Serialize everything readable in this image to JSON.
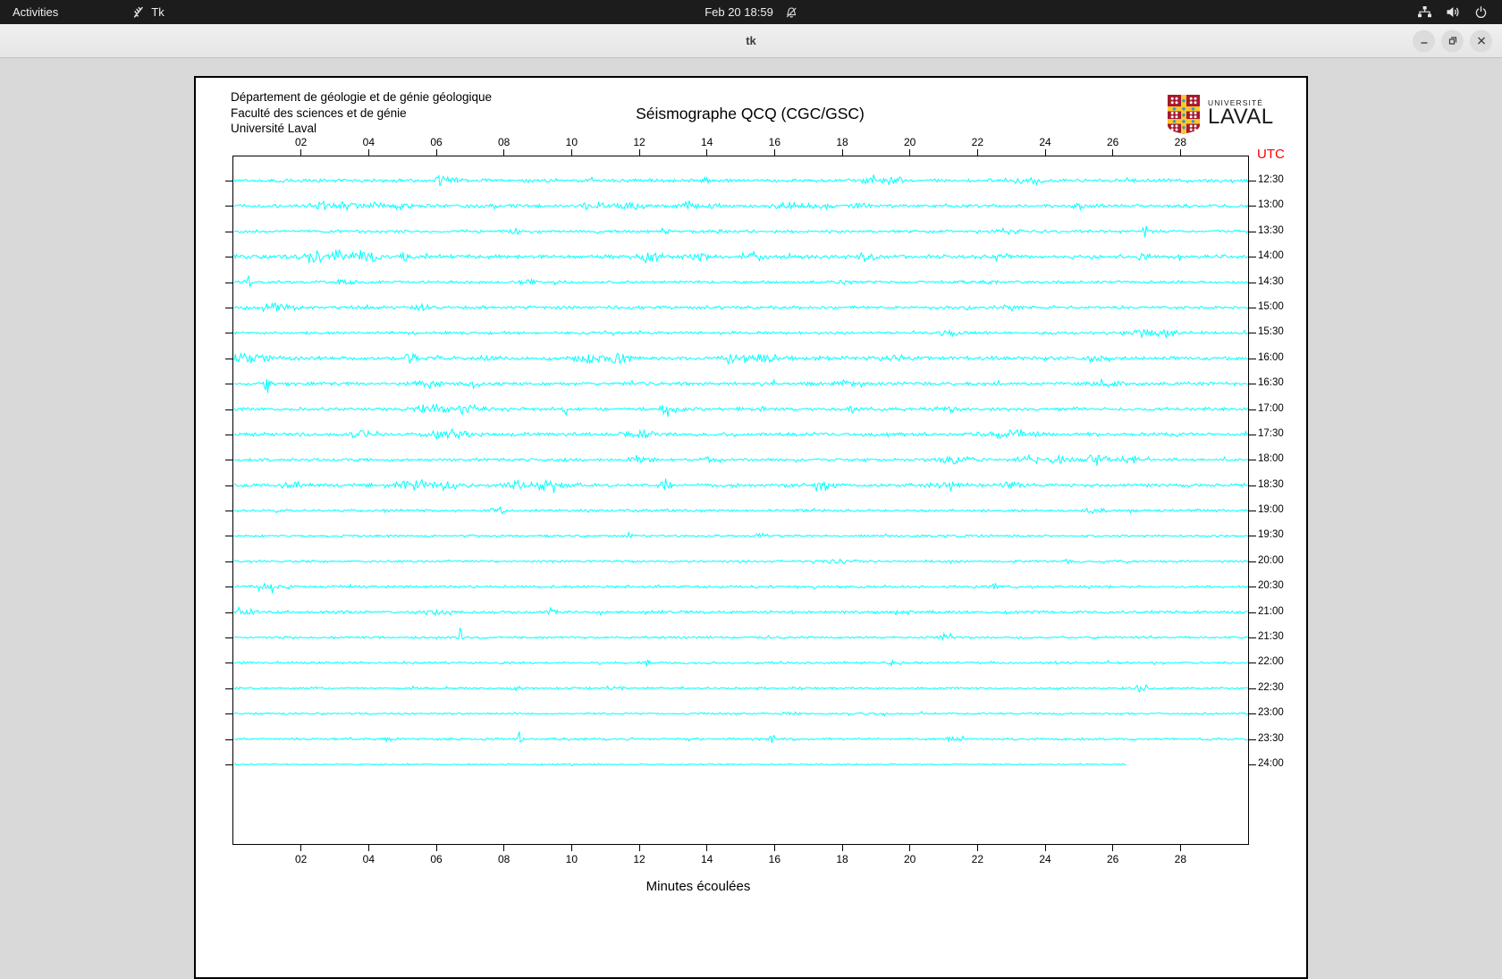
{
  "top_bar": {
    "activities_label": "Activities",
    "app_name": "Tk",
    "clock": "Feb 20 18:59",
    "status_icons": [
      "network-icon",
      "volume-icon",
      "power-icon"
    ],
    "notifications": "disabled"
  },
  "window": {
    "title": "tk",
    "controls": [
      "minimize",
      "maximize",
      "close"
    ]
  },
  "document": {
    "header_lines": [
      "Département de géologie et de génie géologique",
      "Faculté des sciences et de génie",
      "Université Laval"
    ],
    "title": "Séismographe QCQ (CGC/GSC)",
    "logo": {
      "line1": "UNIVERSITÉ",
      "line2": "LAVAL"
    },
    "utc_label": "UTC",
    "xlabel": "Minutes écoulées"
  },
  "colors": {
    "trace": "#00ffff",
    "utc_label": "#ff0000",
    "axis": "#000000",
    "logo_red": "#a6192e",
    "logo_yellow": "#ffc72c",
    "logo_blue": "#2a9bd4"
  },
  "chart_data": {
    "type": "line",
    "subtype": "seismogram-helicorder",
    "station": "QCQ (CGC/GSC)",
    "title": "Séismographe QCQ (CGC/GSC)",
    "xlabel": "Minutes écoulées",
    "ylabel": "UTC",
    "x_axis": {
      "range_minutes": [
        0,
        30
      ],
      "ticks": [
        "02",
        "04",
        "06",
        "08",
        "10",
        "12",
        "14",
        "16",
        "18",
        "20",
        "22",
        "24",
        "26",
        "28"
      ],
      "tick_minutes": [
        2,
        4,
        6,
        8,
        10,
        12,
        14,
        16,
        18,
        20,
        22,
        24,
        26,
        28
      ]
    },
    "row_spacing_minutes": 30,
    "rows": [
      {
        "utc": "12:30",
        "noise": 2.2,
        "bursts": [
          [
            6.05,
            13,
            0.05
          ],
          [
            6.45,
            5,
            0.25
          ],
          [
            14.0,
            12,
            0.05
          ],
          [
            19.0,
            6,
            0.2
          ],
          [
            19.6,
            5,
            0.12
          ],
          [
            23.4,
            3.5,
            0.3
          ]
        ]
      },
      {
        "utc": "13:00",
        "noise": 2.2,
        "bursts": [
          [
            2.6,
            5,
            0.2
          ],
          [
            3.4,
            5,
            0.22
          ],
          [
            4.2,
            4,
            0.18
          ],
          [
            5.0,
            4,
            0.15
          ],
          [
            10.6,
            5,
            0.3
          ],
          [
            11.8,
            5,
            0.22
          ],
          [
            13.4,
            6,
            0.18
          ],
          [
            14.2,
            4,
            0.12
          ],
          [
            16.4,
            4,
            0.3
          ],
          [
            17.4,
            5,
            0.2
          ],
          [
            18.6,
            4,
            0.15
          ],
          [
            25.0,
            5,
            0.12
          ]
        ]
      },
      {
        "utc": "13:30",
        "noise": 1.8,
        "bursts": [
          [
            8.3,
            5,
            0.1
          ],
          [
            12.8,
            4,
            0.15
          ],
          [
            14.4,
            6,
            0.1
          ],
          [
            22.9,
            3,
            0.25
          ],
          [
            27.0,
            11,
            0.07
          ]
        ]
      },
      {
        "utc": "14:00",
        "noise": 2.6,
        "bursts": [
          [
            2.6,
            6,
            0.5
          ],
          [
            3.9,
            6,
            0.35
          ],
          [
            5.05,
            11,
            0.07
          ],
          [
            12.3,
            6,
            0.22
          ],
          [
            13.8,
            5,
            0.18
          ],
          [
            15.3,
            5,
            0.22
          ],
          [
            18.8,
            4,
            0.2
          ],
          [
            22.6,
            4,
            0.2
          ],
          [
            26.9,
            9,
            0.09
          ]
        ]
      },
      {
        "utc": "14:30",
        "noise": 1.9,
        "bursts": [
          [
            0.45,
            10,
            0.06
          ],
          [
            3.4,
            4,
            0.2
          ],
          [
            8.7,
            4,
            0.15
          ],
          [
            17.9,
            3,
            0.2
          ],
          [
            22.4,
            4,
            0.15
          ]
        ]
      },
      {
        "utc": "15:00",
        "noise": 2.1,
        "bursts": [
          [
            1.2,
            4,
            0.4
          ],
          [
            5.6,
            4,
            0.2
          ],
          [
            23.0,
            3,
            0.3
          ]
        ]
      },
      {
        "utc": "15:30",
        "noise": 1.9,
        "bursts": [
          [
            21.2,
            4,
            0.2
          ],
          [
            26.9,
            4.5,
            0.35
          ],
          [
            27.7,
            4,
            0.18
          ]
        ]
      },
      {
        "utc": "16:00",
        "noise": 2.5,
        "bursts": [
          [
            0.5,
            6,
            0.4
          ],
          [
            5.3,
            5,
            0.2
          ],
          [
            7.6,
            4,
            0.2
          ],
          [
            10.4,
            5,
            0.35
          ],
          [
            11.3,
            5,
            0.28
          ],
          [
            14.8,
            5,
            0.35
          ],
          [
            15.8,
            5,
            0.28
          ],
          [
            19.6,
            4,
            0.2
          ],
          [
            25.6,
            4,
            0.25
          ]
        ]
      },
      {
        "utc": "16:30",
        "noise": 2.2,
        "bursts": [
          [
            1.0,
            11,
            0.06
          ],
          [
            5.8,
            4,
            0.3
          ],
          [
            7.0,
            4,
            0.25
          ],
          [
            18.0,
            4,
            0.18
          ],
          [
            25.8,
            4,
            0.2
          ]
        ]
      },
      {
        "utc": "17:00",
        "noise": 2.2,
        "bursts": [
          [
            5.9,
            6,
            0.3
          ],
          [
            6.9,
            6,
            0.22
          ],
          [
            9.85,
            10,
            0.06
          ],
          [
            12.9,
            5,
            0.2
          ],
          [
            18.3,
            6,
            0.1
          ],
          [
            21.0,
            3,
            0.2
          ]
        ]
      },
      {
        "utc": "17:30",
        "noise": 2.4,
        "bursts": [
          [
            3.8,
            4,
            0.3
          ],
          [
            6.4,
            5,
            0.4
          ],
          [
            12.0,
            4,
            0.3
          ],
          [
            23.0,
            4,
            0.5
          ]
        ]
      },
      {
        "utc": "18:00",
        "noise": 2.0,
        "bursts": [
          [
            12.0,
            5,
            0.22
          ],
          [
            14.2,
            5,
            0.18
          ],
          [
            21.3,
            5,
            0.35
          ],
          [
            23.5,
            5,
            0.28
          ],
          [
            24.5,
            5,
            0.28
          ],
          [
            25.5,
            5,
            0.28
          ],
          [
            26.5,
            4,
            0.2
          ]
        ]
      },
      {
        "utc": "18:30",
        "noise": 2.3,
        "bursts": [
          [
            1.7,
            4,
            0.2
          ],
          [
            5.4,
            6,
            0.35
          ],
          [
            6.3,
            5,
            0.28
          ],
          [
            8.5,
            6,
            0.35
          ],
          [
            9.3,
            5,
            0.25
          ],
          [
            12.8,
            6,
            0.12
          ],
          [
            17.5,
            5,
            0.2
          ],
          [
            21.0,
            4,
            0.22
          ],
          [
            23.0,
            4,
            0.2
          ]
        ]
      },
      {
        "utc": "19:00",
        "noise": 1.7,
        "bursts": [
          [
            7.8,
            4,
            0.15
          ],
          [
            25.5,
            3,
            0.2
          ]
        ]
      },
      {
        "utc": "19:30",
        "noise": 1.5,
        "bursts": [
          [
            11.75,
            7,
            0.05
          ],
          [
            15.6,
            4,
            0.1
          ]
        ]
      },
      {
        "utc": "20:00",
        "noise": 1.5,
        "bursts": [
          [
            18.0,
            2,
            0.3
          ],
          [
            24.7,
            8,
            0.05
          ]
        ]
      },
      {
        "utc": "20:30",
        "noise": 1.8,
        "bursts": [
          [
            1.2,
            3,
            0.3
          ],
          [
            22.6,
            3,
            0.2
          ]
        ]
      },
      {
        "utc": "21:00",
        "noise": 2.0,
        "bursts": [
          [
            0.3,
            5,
            0.2
          ],
          [
            6.0,
            3,
            0.3
          ],
          [
            9.4,
            4,
            0.1
          ]
        ]
      },
      {
        "utc": "21:30",
        "noise": 1.5,
        "bursts": [
          [
            6.7,
            11,
            0.05
          ],
          [
            21.0,
            3,
            0.15
          ]
        ]
      },
      {
        "utc": "22:00",
        "noise": 1.5,
        "bursts": [
          [
            12.2,
            4,
            0.1
          ],
          [
            19.5,
            2,
            0.2
          ]
        ]
      },
      {
        "utc": "22:30",
        "noise": 1.5,
        "bursts": [
          [
            8.4,
            4,
            0.1
          ],
          [
            11.3,
            3,
            0.15
          ],
          [
            26.8,
            6,
            0.12
          ]
        ]
      },
      {
        "utc": "23:00",
        "noise": 1.3,
        "bursts": [
          [
            16.5,
            3,
            0.12
          ]
        ]
      },
      {
        "utc": "23:30",
        "noise": 1.5,
        "bursts": [
          [
            4.55,
            6,
            0.07
          ],
          [
            8.45,
            10,
            0.06
          ],
          [
            15.9,
            6,
            0.07
          ],
          [
            21.3,
            3,
            0.15
          ]
        ]
      },
      {
        "utc": "24:00",
        "noise": 1.0,
        "bursts": [],
        "end": 0.88
      }
    ]
  }
}
